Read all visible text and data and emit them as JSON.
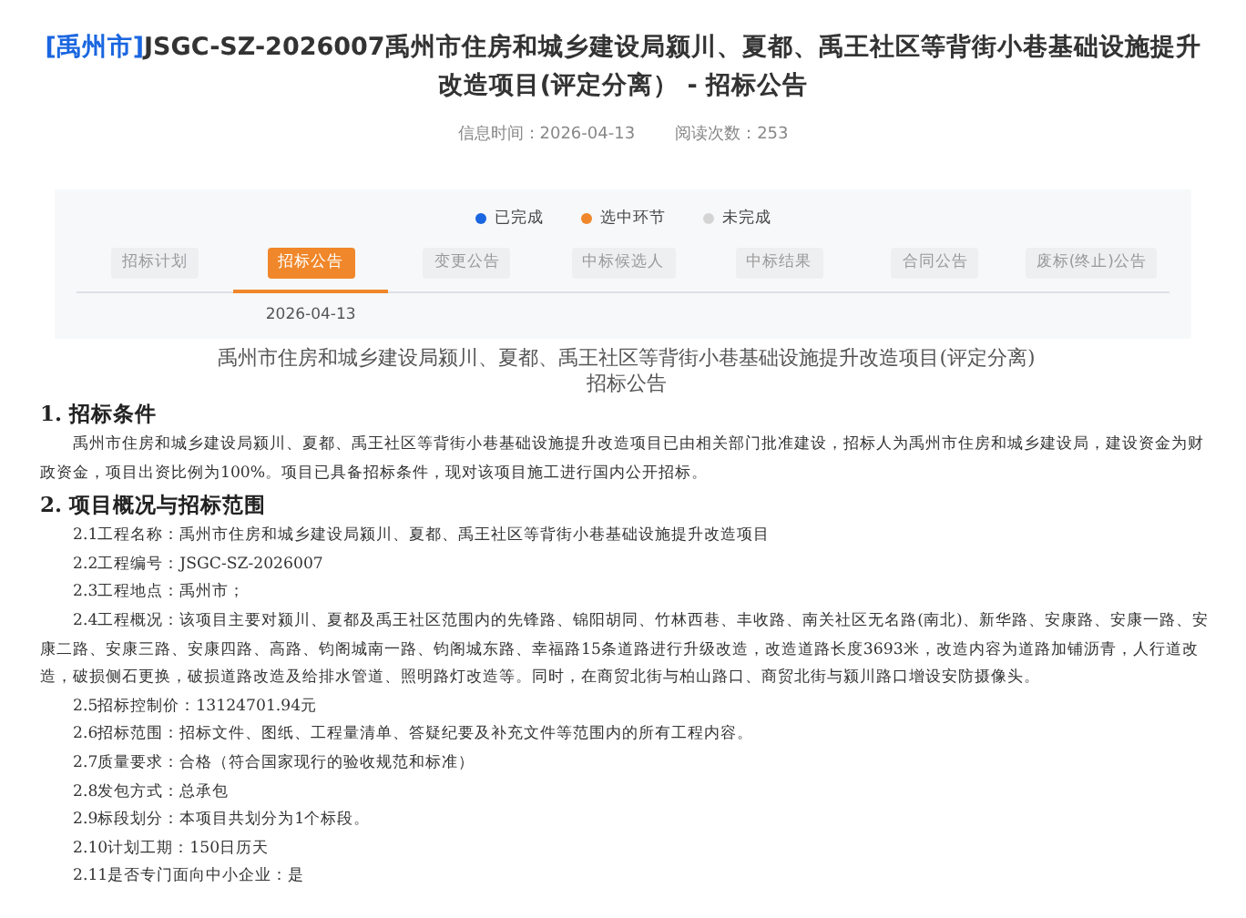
{
  "header": {
    "region_tag": "[禹州市]",
    "title": "JSGC-SZ-2026007禹州市住房和城乡建设局颍川、夏都、禹王社区等背街小巷基础设施提升改造项目(评定分离） - 招标公告",
    "meta": [
      "信息时间：2026-04-13",
      "阅读次数：253"
    ]
  },
  "legend": [
    {
      "label": "已完成",
      "color": "#1a66e0"
    },
    {
      "label": "选中环节",
      "color": "#f0872a"
    },
    {
      "label": "未完成",
      "color": "#d4d4d4"
    }
  ],
  "steps": [
    {
      "label": "招标计划",
      "selected": false
    },
    {
      "label": "招标公告",
      "selected": true,
      "date": "2026-04-13"
    },
    {
      "label": "变更公告",
      "selected": false
    },
    {
      "label": "中标候选人",
      "selected": false
    },
    {
      "label": "中标结果",
      "selected": false
    },
    {
      "label": "合同公告",
      "selected": false
    },
    {
      "label": "废标(终止)公告",
      "selected": false
    }
  ],
  "document": {
    "title_lines": [
      "禹州市住房和城乡建设局颍川、夏都、禹王社区等背街小巷基础设施提升改造项目(评定分离)",
      "招标公告"
    ],
    "sections": [
      {
        "heading": "1. 招标条件",
        "paragraphs": [
          "禹州市住房和城乡建设局颍川、夏都、禹王社区等背街小巷基础设施提升改造项目已由相关部门批准建设，招标人为禹州市住房和城乡建设局，建设资金为财政资金，项目出资比例为100%。项目已具备招标条件，现对该项目施工进行国内公开招标。"
        ]
      },
      {
        "heading": "2. 项目概况与招标范围",
        "paragraphs": [
          "2.1工程名称：禹州市住房和城乡建设局颍川、夏都、禹王社区等背街小巷基础设施提升改造项目",
          "2.2工程编号：JSGC-SZ-2026007",
          "2.3工程地点：禹州市；",
          "2.4工程概况：该项目主要对颍川、夏都及禹王社区范围内的先锋路、锦阳胡同、竹林西巷、丰收路、南关社区无名路(南北)、新华路、安康路、安康一路、安康二路、安康三路、安康四路、高路、钧阁城南一路、钧阁城东路、幸福路15条道路进行升级改造，改造道路长度3693米，改造内容为道路加铺沥青，人行道改造，破损侧石更换，破损道路改造及给排水管道、照明路灯改造等。同时，在商贸北街与柏山路口、商贸北街与颍川路口增设安防摄像头。",
          "2.5招标控制价：13124701.94元",
          "2.6招标范围：招标文件、图纸、工程量清单、答疑纪要及补充文件等范围内的所有工程内容。",
          "2.7质量要求：合格（符合国家现行的验收规范和标准）",
          "2.8发包方式：总承包",
          "2.9标段划分：本项目共划分为1个标段。",
          "2.10计划工期：150日历天",
          "2.11是否专门面向中小企业：是"
        ]
      }
    ]
  }
}
